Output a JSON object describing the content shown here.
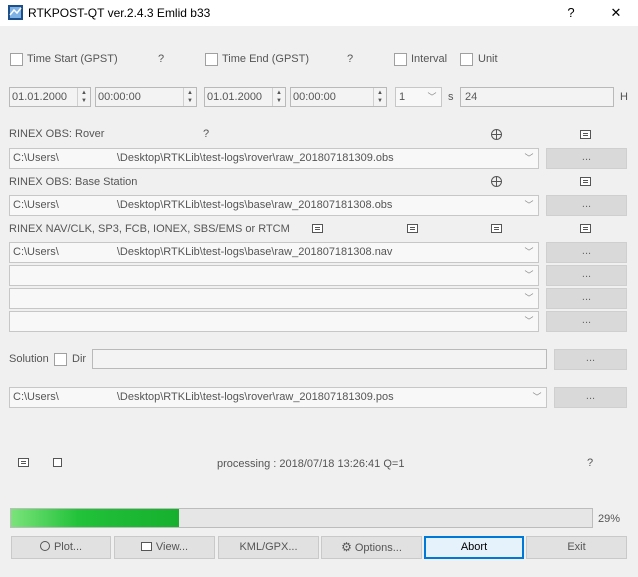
{
  "window": {
    "title": "RTKPOST-QT ver.2.4.3 Emlid b33",
    "help_glyph": "?",
    "close_glyph": "✕"
  },
  "time": {
    "start_label": "Time Start (GPST)",
    "end_label": "Time End (GPST)",
    "interval_label": "Interval",
    "unit_label": "Unit",
    "start_help": "?",
    "end_help": "?",
    "start_date": "01.01.2000",
    "start_time": "00:00:00",
    "end_date": "01.01.2000",
    "end_time": "00:00:00",
    "interval_value": "1",
    "interval_unit": "s",
    "unit_value": "24",
    "unit_suffix": "H"
  },
  "rover": {
    "label": "RINEX OBS: Rover",
    "help": "?",
    "path_prefix": "C:\\Users\\",
    "path_suffix": "\\Desktop\\RTKLib\\test-logs\\rover\\raw_201807181309.obs",
    "browse_label": "..."
  },
  "base": {
    "label": "RINEX OBS: Base Station",
    "path_prefix": "C:\\Users\\",
    "path_suffix": "\\Desktop\\RTKLib\\test-logs\\base\\raw_201807181308.obs",
    "browse_label": "..."
  },
  "nav": {
    "label": "RINEX NAV/CLK, SP3, FCB, IONEX, SBS/EMS  or RTCM",
    "path_prefix": "C:\\Users\\",
    "path_suffix": "\\Desktop\\RTKLib\\test-logs\\base\\raw_201807181308.nav",
    "browse_label": "..."
  },
  "solution": {
    "label": "Solution",
    "dir_label": "Dir",
    "dir_value": "",
    "browse_label": "...",
    "path_prefix": "C:\\Users\\",
    "path_suffix": "\\Desktop\\RTKLib\\test-logs\\rover\\raw_201807181309.pos"
  },
  "status": {
    "message": "processing : 2018/07/18 13:26:41 Q=1",
    "help": "?"
  },
  "progress": {
    "percent": 29,
    "label": "29%"
  },
  "buttons": {
    "plot": "Plot...",
    "view": "View...",
    "kml": "KML/GPX...",
    "options": "Options...",
    "abort": "Abort",
    "exit": "Exit"
  },
  "colors": {
    "accent": "#0078d7",
    "progress_fill": "#16b02e"
  }
}
